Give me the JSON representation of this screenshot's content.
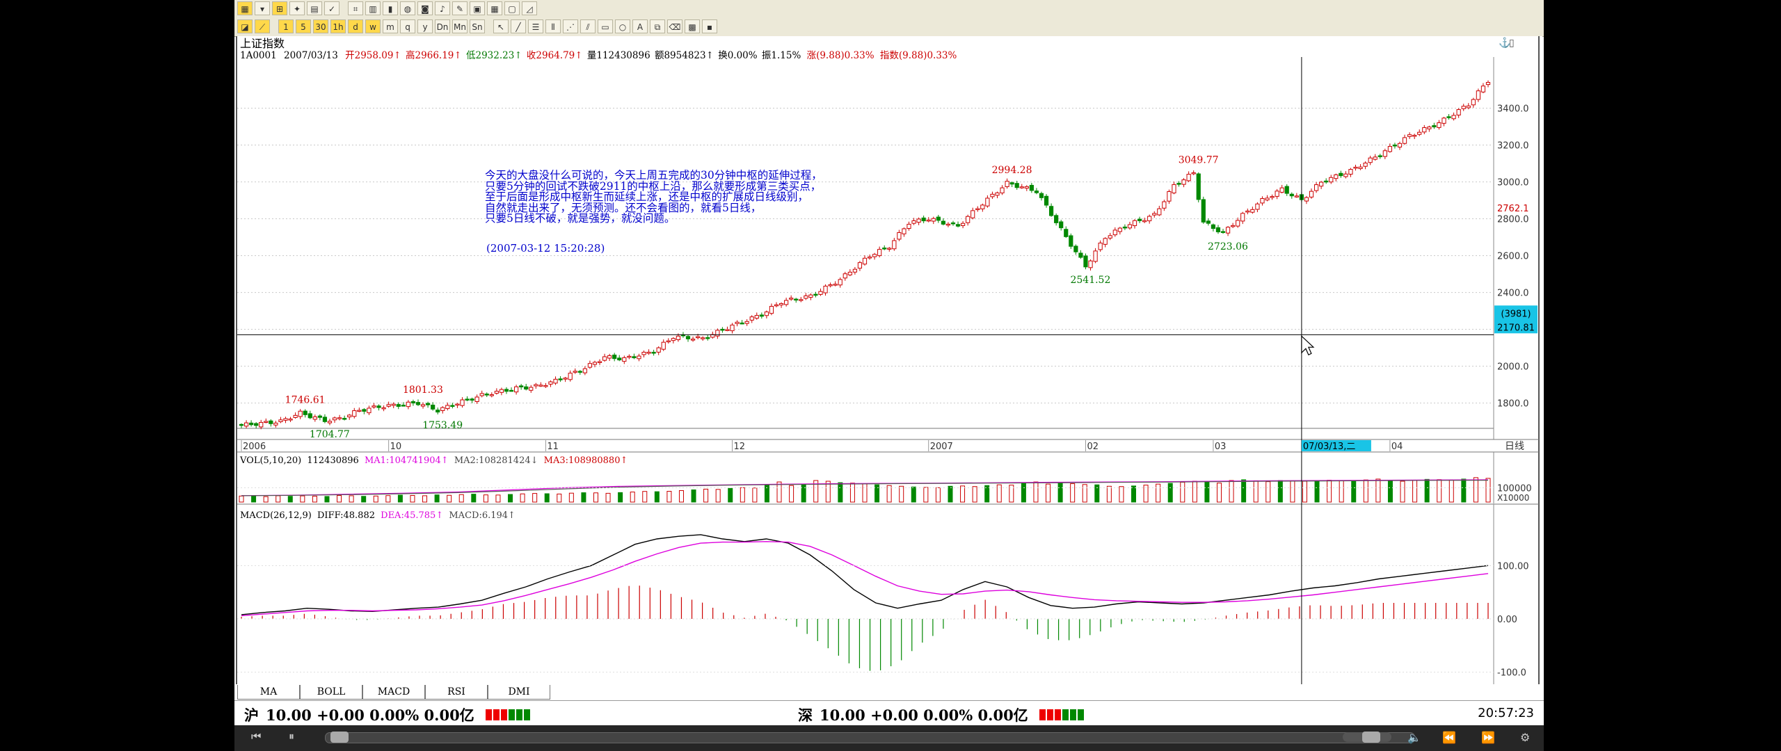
{
  "toolbar": {
    "row1_icons": [
      "chart-icon",
      "dropdown-icon",
      "candle-icon",
      "gift-icon",
      "doc-icon",
      "check-icon",
      "calc-icon",
      "grid-icon",
      "bar-icon",
      "grid-icon",
      "globe-icon",
      "camera-icon",
      "bell-icon",
      "pen-icon",
      "window-icon",
      "calendar-icon",
      "box-icon",
      "doc-icon",
      "graph-icon"
    ],
    "row2_periods": [
      "1",
      "5",
      "30",
      "1h",
      "d",
      "w",
      "m",
      "q",
      "y",
      "Dn",
      "Mn",
      "Sn"
    ]
  },
  "header": {
    "name": "上证指数",
    "code": "1A0001",
    "date": "2007/03/13",
    "open_label": "开",
    "open": "2958.09",
    "high_label": "高",
    "high": "2966.19",
    "low_label": "低",
    "low": "2932.23",
    "close_label": "收",
    "close": "2964.79",
    "vol_label": "量",
    "vol": "112430896",
    "amount_label": "额",
    "amount": "8954823",
    "turnover_label": "换",
    "turnover": "0.00%",
    "amplitude_label": "振",
    "amplitude": "1.15%",
    "change_label": "涨",
    "change": "(9.88)",
    "change_pct": "0.33%",
    "index_label": "指数",
    "index_change": "(9.88)",
    "index_pct": "0.33%"
  },
  "annotation": {
    "lines": [
      "今天的大盘没什么可说的，今天上周五完成的30分钟中枢的延伸过程，",
      "只要5分钟的回试不跌破2911的中枢上沿，那么就要形成第三类买点，",
      "至于后面是形成中枢新生而延续上涨，还是中枢的扩展成日线级别，",
      "自然就走出来了，无须预测。还不会看图的，就看5日线，",
      "只要5日线不破，就是强势，就没问题。"
    ],
    "timestamp": "(2007-03-12 15:20:28)"
  },
  "cursor": {
    "count": "(3981)",
    "value": "2170.81",
    "date": "07/03/13,二",
    "right_value": "2762.1"
  },
  "volume": {
    "title": "VOL(5,10,20)",
    "value": "112430896",
    "ma1_label": "MA1:",
    "ma1": "104741904",
    "ma2_label": "MA2:",
    "ma2": "108281424",
    "ma3_label": "MA3:",
    "ma3": "108980880",
    "scale": "X10000"
  },
  "macd": {
    "title": "MACD(26,12,9)",
    "diff_label": "DIFF:",
    "diff": "48.882",
    "dea_label": "DEA:",
    "dea": "45.785",
    "macd_label": "MACD:",
    "macd": "6.194"
  },
  "bottom_tabs": [
    "MA",
    "BOLL",
    "MACD",
    "RSI",
    "DMI"
  ],
  "ticker": {
    "sh_label": "沪",
    "sh": "10.00 +0.00 0.00% 0.00亿",
    "sz_label": "深",
    "sz": "10.00 +0.00 0.00% 0.00亿",
    "time": "20:57:23"
  },
  "chart_data": [
    {
      "type": "candlestick",
      "title": "上证指数",
      "x_tick_labels": [
        "2006",
        "10",
        "11",
        "12",
        "2007",
        "02",
        "03",
        "04"
      ],
      "y_tick_labels": [
        "1800.0",
        "2000.0",
        "2200.0",
        "2400.0",
        "2600.0",
        "2800.0",
        "3000.0",
        "3200.0",
        "3400.0"
      ],
      "ylim": [
        1640,
        3640
      ],
      "x_axis_label": "日线",
      "annotations": [
        {
          "label": "1746.61",
          "value": 1746.61
        },
        {
          "label": "1704.77",
          "value": 1704.77
        },
        {
          "label": "1801.33",
          "value": 1801.33
        },
        {
          "label": "1753.49",
          "value": 1753.49
        },
        {
          "label": "2994.28",
          "value": 2994.28
        },
        {
          "label": "2541.52",
          "value": 2541.52
        },
        {
          "label": "3049.77",
          "value": 3049.77
        },
        {
          "label": "2723.06",
          "value": 2723.06
        }
      ],
      "close_path": [
        [
          0,
          1680
        ],
        [
          8,
          1700
        ],
        [
          12,
          1746
        ],
        [
          17,
          1705
        ],
        [
          20,
          1715
        ],
        [
          24,
          1760
        ],
        [
          28,
          1780
        ],
        [
          32,
          1790
        ],
        [
          36,
          1801
        ],
        [
          40,
          1760
        ],
        [
          44,
          1800
        ],
        [
          50,
          1850
        ],
        [
          56,
          1880
        ],
        [
          60,
          1890
        ],
        [
          64,
          1920
        ],
        [
          70,
          1990
        ],
        [
          74,
          2050
        ],
        [
          78,
          2040
        ],
        [
          84,
          2080
        ],
        [
          88,
          2160
        ],
        [
          94,
          2150
        ],
        [
          100,
          2220
        ],
        [
          106,
          2280
        ],
        [
          110,
          2350
        ],
        [
          116,
          2380
        ],
        [
          122,
          2470
        ],
        [
          128,
          2600
        ],
        [
          132,
          2650
        ],
        [
          136,
          2780
        ],
        [
          140,
          2800
        ],
        [
          146,
          2760
        ],
        [
          150,
          2860
        ],
        [
          156,
          2994
        ],
        [
          162,
          2950
        ],
        [
          168,
          2700
        ],
        [
          172,
          2541
        ],
        [
          176,
          2700
        ],
        [
          180,
          2760
        ],
        [
          186,
          2820
        ],
        [
          190,
          2980
        ],
        [
          194,
          3049
        ],
        [
          196,
          2780
        ],
        [
          200,
          2723
        ],
        [
          204,
          2820
        ],
        [
          208,
          2900
        ],
        [
          212,
          2960
        ],
        [
          216,
          2900
        ],
        [
          220,
          3000
        ],
        [
          226,
          3060
        ],
        [
          232,
          3150
        ],
        [
          238,
          3250
        ],
        [
          244,
          3320
        ],
        [
          250,
          3420
        ],
        [
          254,
          3550
        ]
      ],
      "last_index": 254,
      "cursor_index": 216
    },
    {
      "type": "bar",
      "title": "VOL(5,10,20)",
      "y_tick_labels": [
        "100000"
      ],
      "ylim": [
        0,
        300000
      ],
      "series": [
        {
          "name": "VOL",
          "values": [
            42000,
            45000,
            38000,
            44000,
            40000,
            43000,
            41000,
            39000,
            46000,
            44000,
            40000,
            42000,
            45000,
            48000,
            46000,
            44000,
            50000,
            47000,
            52000,
            55000,
            50000,
            49000,
            53000,
            57000,
            60000,
            58000,
            56000,
            62000,
            65000,
            64000,
            61000,
            66000,
            70000,
            74000,
            72000,
            75000,
            80000,
            85000,
            90000,
            88000,
            95000,
            100000,
            98000,
            120000,
            140000,
            115000,
            125000,
            150000,
            145000,
            135000,
            132000,
            128000,
            120000,
            115000,
            110000,
            105000,
            102000,
            100000,
            110000,
            112000,
            108000,
            115000,
            120000,
            118000,
            130000,
            140000,
            125000,
            135000,
            128000,
            122000,
            120000,
            110000,
            108000,
            112000,
            118000,
            125000,
            130000,
            138000,
            145000,
            140000,
            132000,
            150000,
            155000,
            148000,
            142000,
            150000,
            148000,
            145000,
            150000,
            152000,
            149000,
            147000,
            154000,
            160000,
            150000,
            145000,
            152000,
            158000,
            156000,
            154000,
            160000,
            170000,
            165000
          ]
        },
        {
          "name": "MA1",
          "values": [
            45000,
            48000,
            55000,
            62000,
            70000,
            85000,
            100000,
            110000,
            115000,
            120000,
            125000,
            128000,
            130000,
            132000,
            135000,
            138000,
            140000,
            142000,
            145000,
            148000,
            150000,
            152000,
            154000,
            155000
          ]
        },
        {
          "name": "MA2",
          "values": [
            44000,
            47000,
            52000,
            58000,
            66000,
            78000,
            92000,
            104000,
            112000,
            118000,
            122000,
            125000,
            128000,
            130000,
            132000,
            134000,
            137000,
            139000,
            142000,
            145000,
            147000,
            149000,
            151000,
            152000
          ]
        }
      ]
    },
    {
      "type": "line",
      "title": "MACD(26,12,9)",
      "y_tick_labels": [
        "100.00",
        "0.00",
        "-100.0"
      ],
      "ylim": [
        -120,
        180
      ],
      "series": [
        {
          "name": "DIFF",
          "values": [
            8,
            12,
            15,
            20,
            18,
            15,
            14,
            17,
            20,
            22,
            28,
            35,
            48,
            60,
            75,
            88,
            100,
            120,
            140,
            150,
            155,
            158,
            150,
            145,
            150,
            142,
            120,
            90,
            55,
            30,
            20,
            28,
            35,
            55,
            70,
            60,
            40,
            25,
            20,
            22,
            28,
            32,
            30,
            28,
            30,
            35,
            40,
            45,
            52,
            58,
            62,
            68,
            75,
            80,
            85,
            90,
            95,
            100
          ]
        },
        {
          "name": "DEA",
          "values": [
            6,
            9,
            12,
            15,
            16,
            16,
            15,
            16,
            17,
            19,
            22,
            26,
            34,
            44,
            55,
            66,
            78,
            92,
            108,
            122,
            134,
            142,
            144,
            144,
            145,
            144,
            136,
            120,
            100,
            80,
            62,
            52,
            46,
            47,
            52,
            54,
            51,
            45,
            40,
            36,
            34,
            33,
            32,
            31,
            31,
            32,
            34,
            37,
            41,
            45,
            50,
            55,
            60,
            65,
            70,
            75,
            80,
            85
          ]
        }
      ]
    }
  ]
}
